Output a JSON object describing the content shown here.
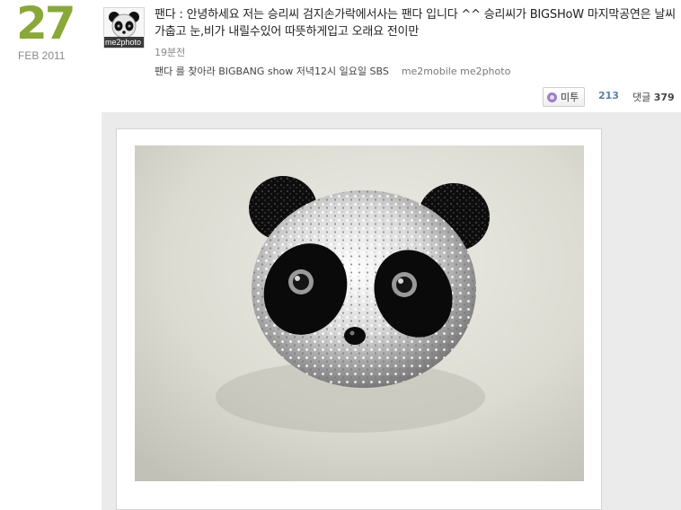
{
  "date": {
    "day": "27",
    "month_year": "FEB 2011"
  },
  "avatar": {
    "label": "me2photo",
    "icon": "panda-avatar-icon"
  },
  "post": {
    "text": "팬다 : 안녕하세요 저는 승리씨 검지손가락에서사는 팬다 입니다 ^^ 승리씨가 BIGSHoW 마지막공연은 날씨가춥고 눈,비가 내릴수있어 따뜻하게입고 오래요 전이만",
    "time": "19분전",
    "tags": "팬다 를 찾아라 BIGBANG show 저녁12시 일요일 SBS",
    "app_links": "me2mobile me2photo"
  },
  "actions": {
    "metoo_label": "미투",
    "metoo_count": "213",
    "comment_label": "댓글",
    "comment_count": "379"
  },
  "photo": {
    "subject": "panda-ring-photo"
  },
  "colors": {
    "date_green": "#8aa839",
    "metoo_purple": "#9b7fc9",
    "count_blue": "#5a7fa8"
  }
}
